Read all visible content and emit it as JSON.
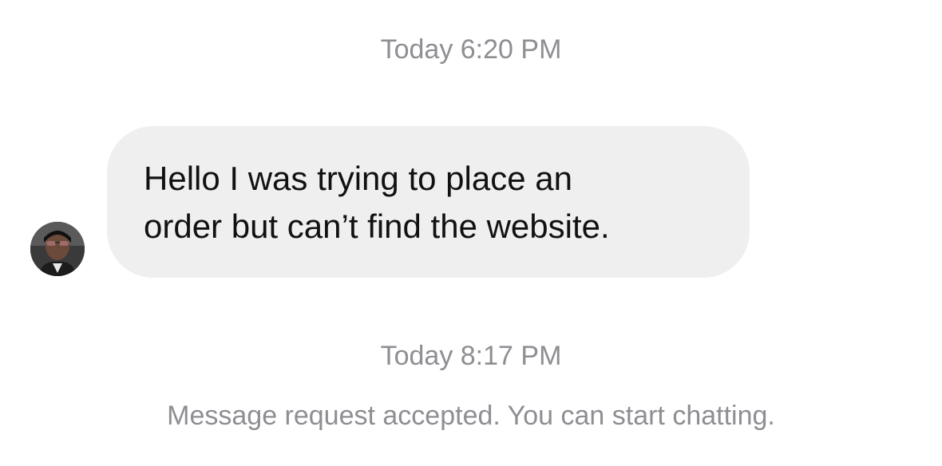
{
  "conversation": {
    "timestamp_first": "Today 6:20 PM",
    "timestamp_second": "Today 8:17 PM",
    "incoming_message": {
      "line_1": "Hello I was trying to place an",
      "line_2": "order but can’t find the website."
    },
    "system_note": "Message request accepted. You can start chatting."
  },
  "colors": {
    "timestamp_text": "#8e8e93",
    "bubble_background": "#efefef",
    "message_text": "#111111"
  }
}
